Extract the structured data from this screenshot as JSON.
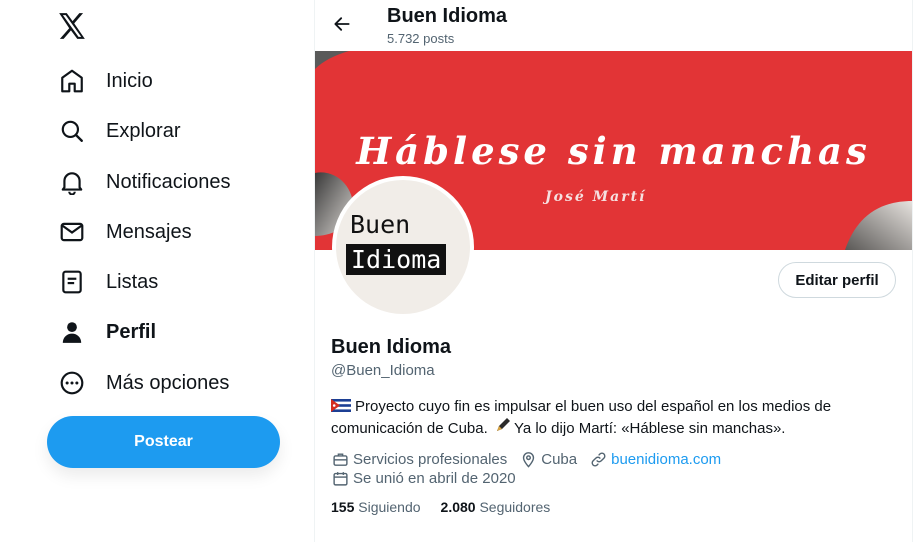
{
  "sidebar": {
    "logo_icon": "x-logo-icon",
    "items": [
      {
        "label": "Inicio",
        "icon": "home-icon"
      },
      {
        "label": "Explorar",
        "icon": "search-icon"
      },
      {
        "label": "Notificaciones",
        "icon": "bell-icon"
      },
      {
        "label": "Mensajes",
        "icon": "envelope-icon"
      },
      {
        "label": "Listas",
        "icon": "list-icon"
      },
      {
        "label": "Perfil",
        "icon": "user-icon",
        "active": true
      },
      {
        "label": "Más opciones",
        "icon": "more-circle-icon"
      }
    ],
    "post_label": "Postear"
  },
  "header": {
    "title": "Buen Idioma",
    "posts_count": "5.732 posts"
  },
  "banner": {
    "quote": "Háblese sin manchas",
    "author": "José Martí",
    "color": "#e23436"
  },
  "avatar": {
    "line1": "Buen",
    "line2": "Idioma"
  },
  "profile": {
    "edit_label": "Editar perfil",
    "name": "Buen Idioma",
    "handle": "@Buen_Idioma",
    "bio_part1": "Proyecto cuyo fin es impulsar el buen uso del español en los medios de comunicación de Cuba.",
    "bio_part2": "Ya lo dijo Martí: «Háblese sin manchas».",
    "category": "Servicios profesionales",
    "location": "Cuba",
    "website": "buenidioma.com",
    "joined": "Se unió en abril de 2020",
    "following_count": "155",
    "following_label": "Siguiendo",
    "followers_count": "2.080",
    "followers_label": "Seguidores"
  },
  "colors": {
    "accent": "#1d9bf0",
    "text": "#0f1419",
    "muted": "#536471"
  }
}
